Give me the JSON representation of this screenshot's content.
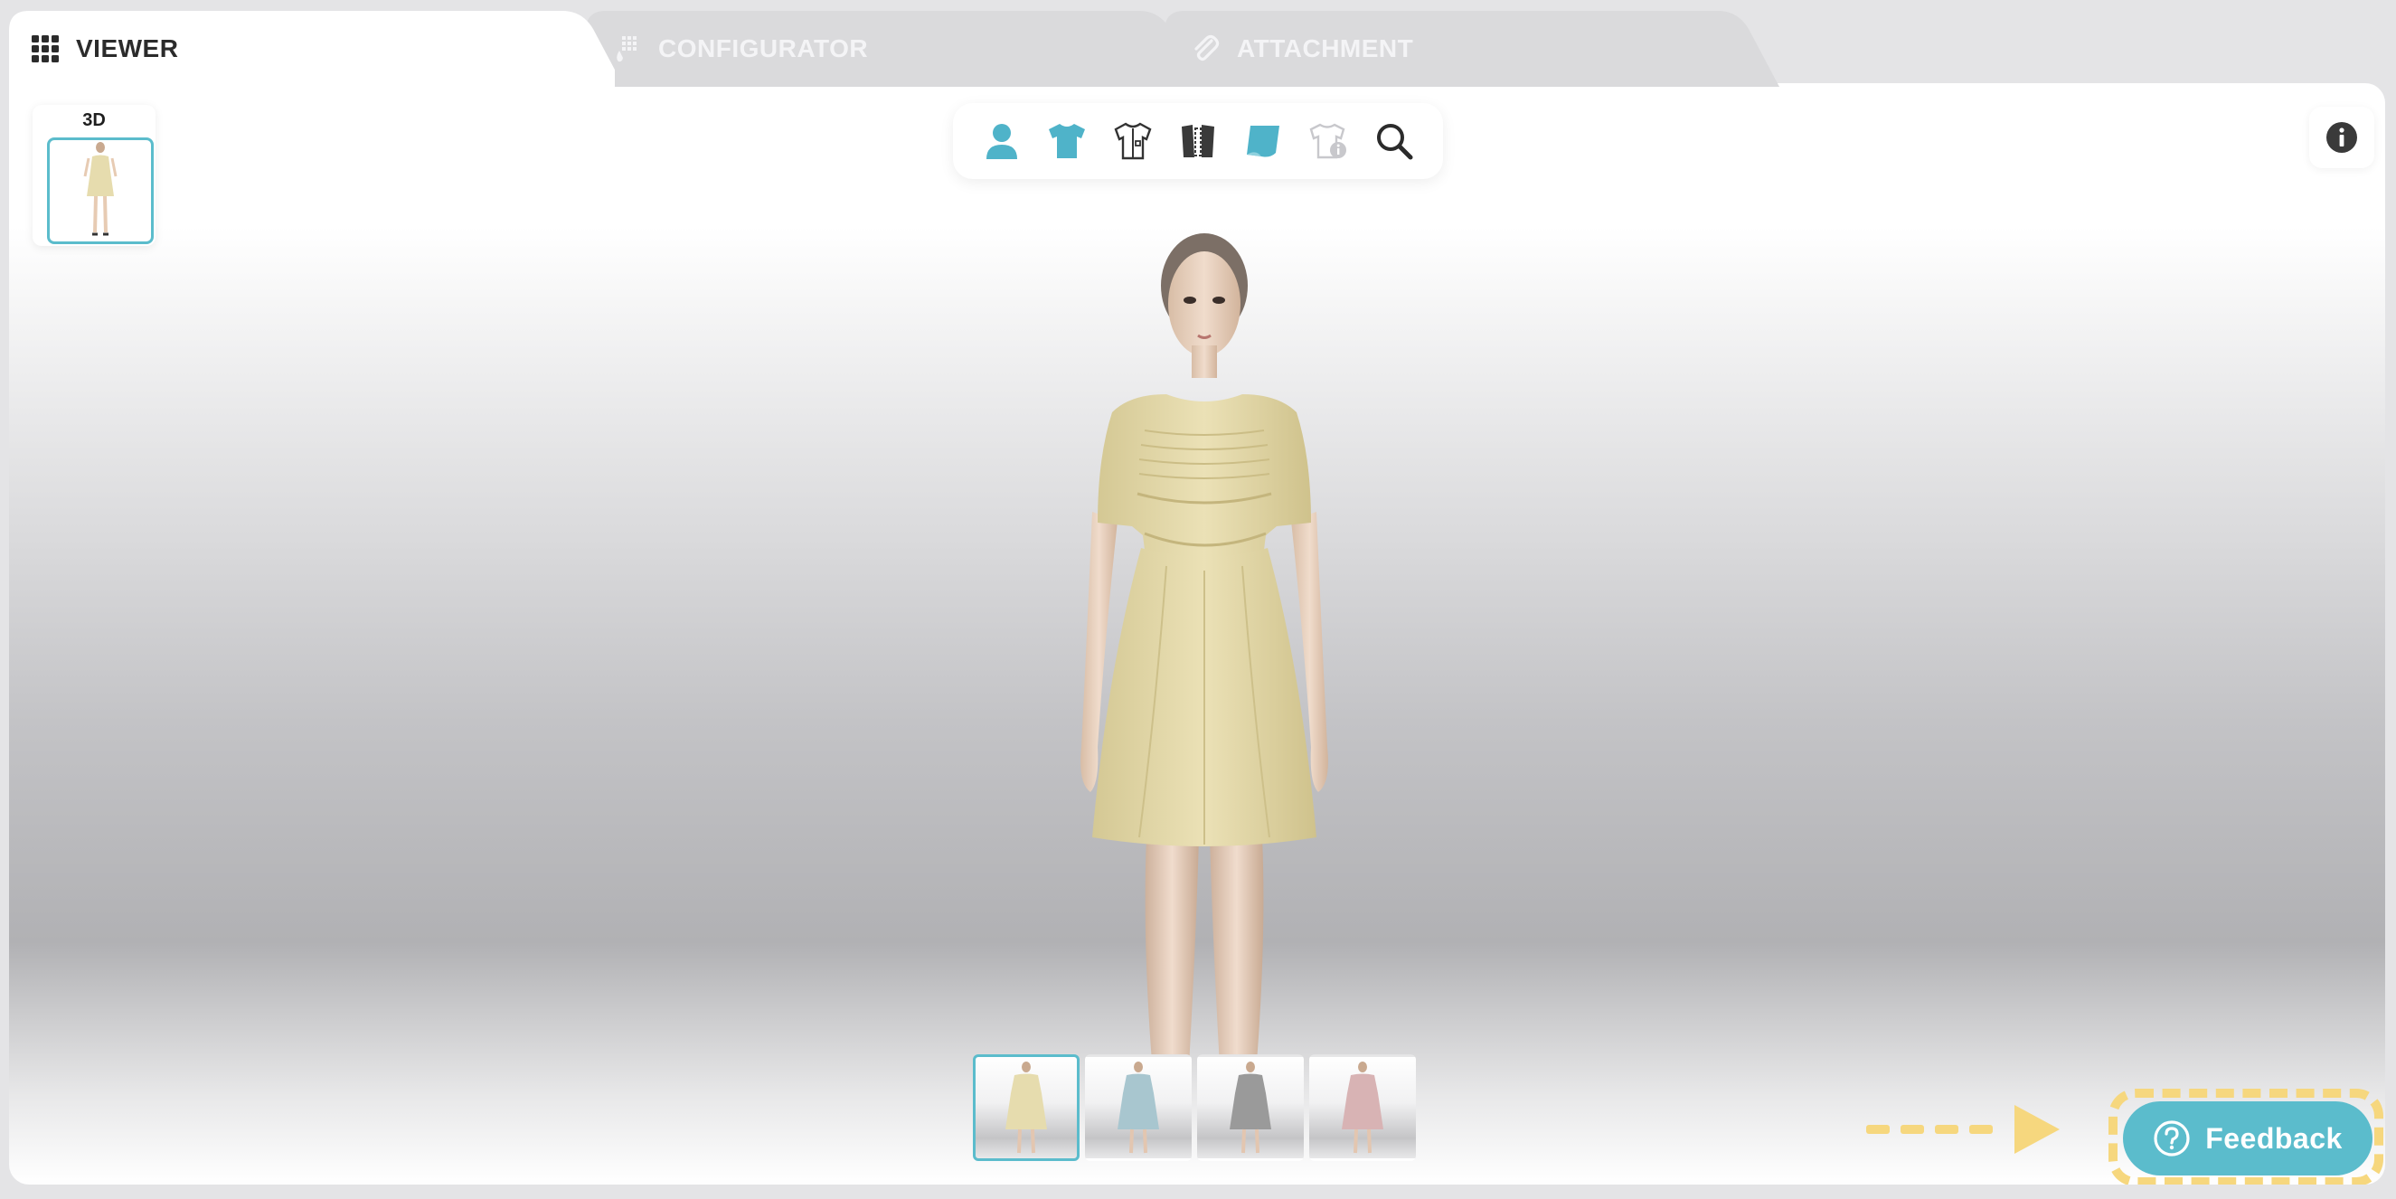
{
  "tabs": [
    {
      "label": "VIEWER",
      "icon": "grid-icon",
      "active": true
    },
    {
      "label": "CONFIGURATOR",
      "icon": "swatch-icon",
      "active": false
    },
    {
      "label": "ATTACHMENT",
      "icon": "paperclip-icon",
      "active": false
    }
  ],
  "viewer": {
    "view_label": "3D",
    "toolbar": [
      {
        "icon": "avatar-icon"
      },
      {
        "icon": "tshirt-icon"
      },
      {
        "icon": "garment-outline-icon"
      },
      {
        "icon": "pattern-pieces-icon"
      },
      {
        "icon": "fabric-icon"
      },
      {
        "icon": "garment-info-icon"
      },
      {
        "icon": "zoom-icon"
      }
    ],
    "info_icon": "info-icon",
    "colorways": [
      {
        "color": "#e6dcae",
        "selected": true
      },
      {
        "color": "#a8c6cf",
        "selected": false
      },
      {
        "color": "#9a9a9a",
        "selected": false
      },
      {
        "color": "#d8b3b4",
        "selected": false
      }
    ]
  },
  "feedback": {
    "label": "Feedback",
    "icon": "help-circle-icon"
  },
  "colors": {
    "accent": "#5bbccc",
    "highlight": "#f6d77e",
    "dress": "#e6dcae"
  }
}
